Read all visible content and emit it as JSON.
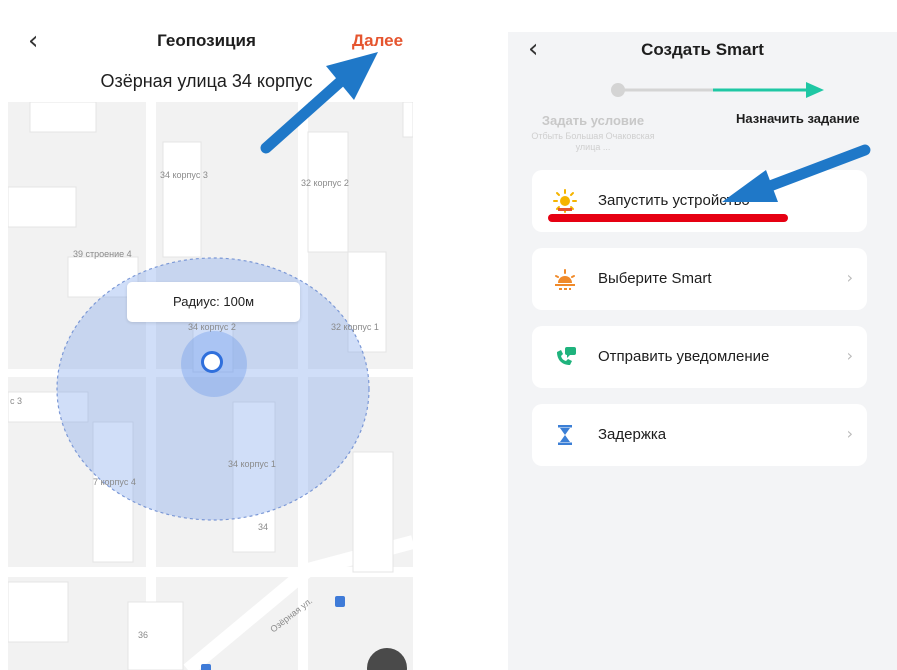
{
  "left": {
    "back_icon": "chevron-left-icon",
    "title": "Геопозиция",
    "next_label": "Далее",
    "address": "Озёрная улица 34 корпус",
    "radius_label": "Радиус: 100м",
    "building_labels": [
      "34 корпус 3",
      "32 корпус 2",
      "39 строение 4",
      "34 корпус 2",
      "32 корпус 1",
      "с 3",
      "34 корпус 1",
      "7 корпус 4",
      "34",
      "36"
    ],
    "street_label": "Озёрная ул."
  },
  "right": {
    "back_icon": "chevron-left-icon",
    "title": "Создать Smart",
    "step1_label": "Задать условие",
    "step1_sublabel": "Отбыть Большая Очаковская улица ...",
    "step2_label": "Назначить задание",
    "actions": [
      {
        "label": "Запустить устройство",
        "icon": "sun-device-icon"
      },
      {
        "label": "Выберите Smart",
        "icon": "sunrise-scene-icon"
      },
      {
        "label": "Отправить уведомление",
        "icon": "phone-message-icon"
      },
      {
        "label": "Задержка",
        "icon": "hourglass-icon"
      }
    ]
  },
  "colors": {
    "next_accent": "#e5552f",
    "step_line_active": "#1fc7a4",
    "annotation_arrow": "#1f78c8",
    "underline": "#e60012",
    "radius_circle": "#a9c2f0"
  }
}
